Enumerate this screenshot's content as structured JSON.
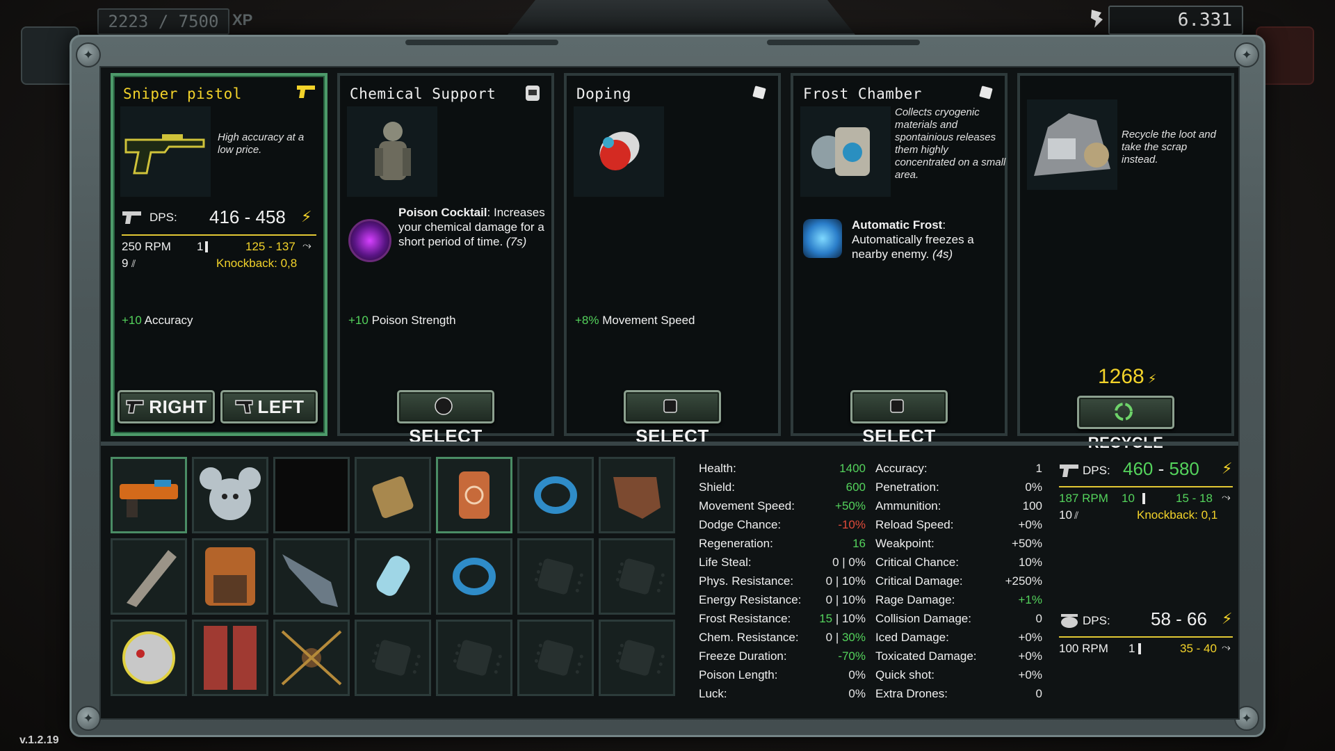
{
  "top": {
    "xp": "2223 / 7500",
    "xp_label": "XP",
    "scrap": "6.331"
  },
  "cards": [
    {
      "title": "Sniper pistol",
      "desc": "High accuracy at a low price.",
      "dps_label": "DPS:",
      "dps": "416 - 458",
      "rpm": "250 RPM",
      "ammo": "1",
      "damage": "125 - 137",
      "mag": "9",
      "knockback": "Knockback: 0,8",
      "bonus_value": "+10",
      "bonus_label": "Accuracy",
      "btn_right": "RIGHT",
      "btn_left": "LEFT"
    },
    {
      "title": "Chemical Support",
      "perk_name": "Poison Cocktail",
      "perk_colon": ":",
      "perk_desc": "Increases your chemical damage for a short period of time.",
      "perk_time": "(7s)",
      "bonus_value": "+10",
      "bonus_label": "Poison Strength",
      "btn": "SELECT"
    },
    {
      "title": "Doping",
      "bonus_value": "+8%",
      "bonus_label": "Movement Speed",
      "btn": "SELECT"
    },
    {
      "title": "Frost Chamber",
      "desc": "Collects cryogenic materials and spontainious releases them highly concentrated on a small area.",
      "perk_name": "Automatic Frost",
      "perk_colon": ":",
      "perk_desc": "Automatically freezes a nearby enemy.",
      "perk_time": "(4s)",
      "btn": "SELECT"
    },
    {
      "desc": "Recycle the loot and take the scrap instead.",
      "amount": "1268",
      "btn": "RECYCLE"
    }
  ],
  "stats_left": [
    {
      "label": "Health:",
      "value": "1400",
      "color": "green"
    },
    {
      "label": "Shield:",
      "value": "600",
      "color": "green"
    },
    {
      "label": "Movement Speed:",
      "value": "+50%",
      "color": "green"
    },
    {
      "label": "Dodge Chance:",
      "value": "-10%",
      "color": "red"
    },
    {
      "label": "Regeneration:",
      "value": "16",
      "color": "green"
    },
    {
      "label": "Life Steal:",
      "value": "0 | 0%",
      "color": "white"
    },
    {
      "label": "Phys. Resistance:",
      "value": "0 | 10%",
      "color": "white"
    },
    {
      "label": "Energy Resistance:",
      "value": "0 | 10%",
      "color": "white"
    },
    {
      "label": "Frost Resistance:",
      "value_a": "15",
      "value_b": " | 10%",
      "color": "mixed"
    },
    {
      "label": "Chem. Resistance:",
      "value_a": "0 | ",
      "value_b": "30%",
      "color": "mixed2"
    },
    {
      "label": "Freeze Duration:",
      "value": "-70%",
      "color": "green"
    },
    {
      "label": "Poison Length:",
      "value": "0%",
      "color": "white"
    },
    {
      "label": "Luck:",
      "value": "0%",
      "color": "white"
    }
  ],
  "stats_right": [
    {
      "label": "Accuracy:",
      "value": "1",
      "color": "white"
    },
    {
      "label": "Penetration:",
      "value": "0%",
      "color": "white"
    },
    {
      "label": "Ammunition:",
      "value": "100",
      "color": "white"
    },
    {
      "label": "Reload Speed:",
      "value": "+0%",
      "color": "white"
    },
    {
      "label": "Weakpoint:",
      "value": "+50%",
      "color": "white"
    },
    {
      "label": "Critical Chance:",
      "value": "10%",
      "color": "white"
    },
    {
      "label": "Critical Damage:",
      "value": "+250%",
      "color": "white"
    },
    {
      "label": "Rage Damage:",
      "value": "+1%",
      "color": "green"
    },
    {
      "label": "Collision Damage:",
      "value": "0",
      "color": "white"
    },
    {
      "label": "Iced Damage:",
      "value": "+0%",
      "color": "white"
    },
    {
      "label": "Toxicated Damage:",
      "value": "+0%",
      "color": "white"
    },
    {
      "label": "Quick shot:",
      "value": "+0%",
      "color": "white"
    },
    {
      "label": "Extra Drones:",
      "value": "0",
      "color": "white"
    }
  ],
  "weapon_main": {
    "dps_label": "DPS:",
    "dps_a": "460",
    "dps_sep": " - ",
    "dps_b": "580",
    "rpm": "187 RPM",
    "ammo": "10",
    "damage": "15 - 18",
    "mag": "10",
    "knockback": "Knockback: 0,1"
  },
  "weapon_drone": {
    "dps_label": "DPS:",
    "dps": "58 - 66",
    "rpm": "100 RPM",
    "ammo": "1",
    "damage": "35 - 40"
  },
  "version": "v.1.2.19"
}
